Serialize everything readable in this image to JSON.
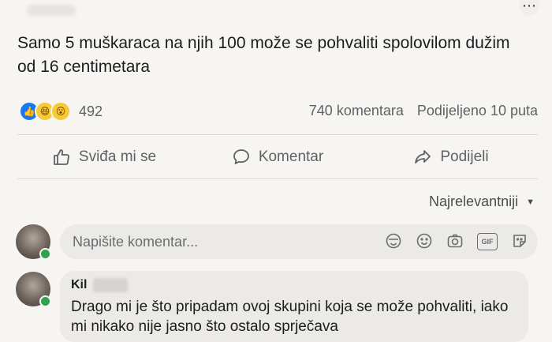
{
  "post": {
    "text": "Samo 5 muškaraca na njih 100 može se pohvaliti spolovilom dužim od 16 centimetara"
  },
  "stats": {
    "reaction_count": "492",
    "reactions": [
      "like-icon",
      "haha-icon",
      "wow-icon"
    ],
    "comments": "740 komentara",
    "shares": "Podijeljeno 10 puta"
  },
  "actions": {
    "like": "Sviđa mi se",
    "comment": "Komentar",
    "share": "Podijeli"
  },
  "sort": {
    "label": "Najrelevantniji"
  },
  "composer": {
    "placeholder": "Napišite komentar...",
    "icons": [
      "avatar-sticker-icon",
      "emoji-icon",
      "camera-icon",
      "gif-icon",
      "sticker-icon"
    ],
    "gif_label": "GIF"
  },
  "comment": {
    "author_visible": "Kil",
    "text": "Drago mi je što pripadam ovoj skupini koja se može pohvaliti, iako mi nikako nije jasno što ostalo sprječava"
  },
  "colors": {
    "background": "#f6f5f2",
    "like_blue": "#1877f2",
    "online_green": "#31a24c",
    "bubble": "#eceae6"
  }
}
